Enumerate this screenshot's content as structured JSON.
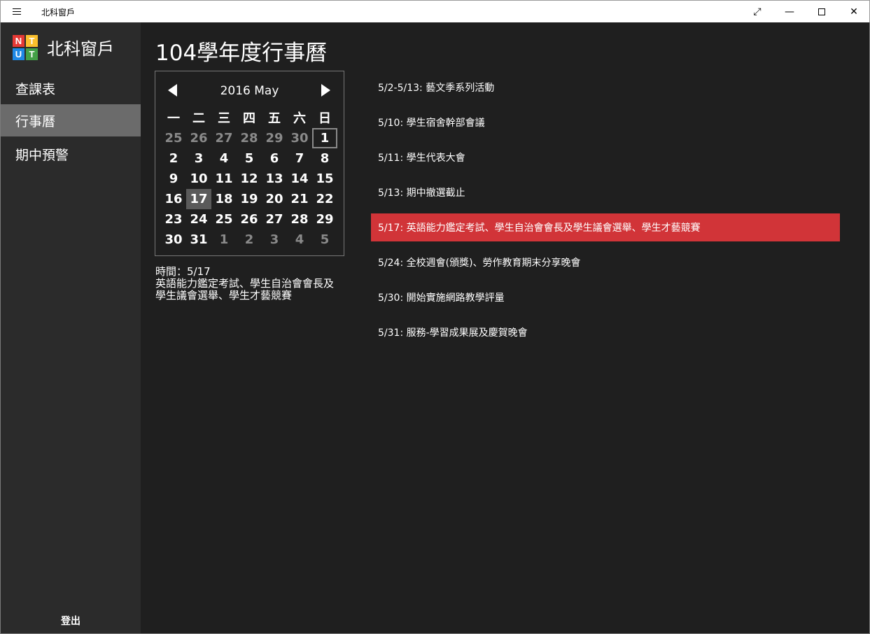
{
  "window": {
    "title": "北科窗戶"
  },
  "sidebar": {
    "app_name": "北科窗戶",
    "logo_letters": [
      "N",
      "T",
      "U",
      "T"
    ],
    "logo_colors": [
      "#e53935",
      "#fbc02d",
      "#1e88e5",
      "#43a047"
    ],
    "items": [
      {
        "label": "查課表",
        "active": false
      },
      {
        "label": "行事曆",
        "active": true
      },
      {
        "label": "期中預警",
        "active": false
      }
    ],
    "logout_label": "登出"
  },
  "main": {
    "title": "104學年度行事曆",
    "calendar": {
      "month_label": "2016 May",
      "weekday_headers": [
        "一",
        "二",
        "三",
        "四",
        "五",
        "六",
        "日"
      ],
      "weeks": [
        [
          "25",
          "26",
          "27",
          "28",
          "29",
          "30",
          "1"
        ],
        [
          "2",
          "3",
          "4",
          "5",
          "6",
          "7",
          "8"
        ],
        [
          "9",
          "10",
          "11",
          "12",
          "13",
          "14",
          "15"
        ],
        [
          "16",
          "17",
          "18",
          "19",
          "20",
          "21",
          "22"
        ],
        [
          "23",
          "24",
          "25",
          "26",
          "27",
          "28",
          "29"
        ],
        [
          "30",
          "31",
          "1",
          "2",
          "3",
          "4",
          "5"
        ]
      ],
      "today": "1",
      "selected": "17"
    },
    "detail": {
      "time_line": "時間：5/17",
      "line1": "英語能力鑑定考試、學生自治會會長及",
      "line2": "學生議會選舉、學生才藝競賽"
    },
    "events": [
      {
        "text": "5/2-5/13: 藝文季系列活動",
        "active": false
      },
      {
        "text": "5/10: 學生宿舍幹部會議",
        "active": false
      },
      {
        "text": "5/11: 學生代表大會",
        "active": false
      },
      {
        "text": "5/13: 期中撤選截止",
        "active": false
      },
      {
        "text": "5/17: 英語能力鑑定考試、學生自治會會長及學生議會選舉、學生才藝競賽",
        "active": true
      },
      {
        "text": "5/24: 全校週會(頒獎)、勞作教育期末分享晚會",
        "active": false
      },
      {
        "text": "5/30: 開始實施網路教學評量",
        "active": false
      },
      {
        "text": "5/31: 服務-學習成果展及慶賀晚會",
        "active": false
      }
    ],
    "accent_color": "#d13438"
  }
}
